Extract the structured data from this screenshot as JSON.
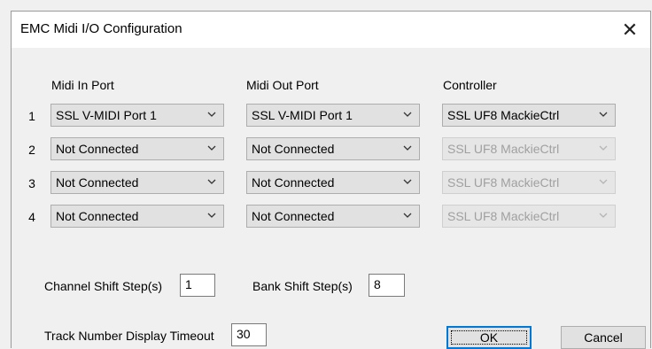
{
  "window": {
    "title": "EMC Midi I/O Configuration",
    "close_glyph": "✕"
  },
  "headers": {
    "midi_in": "Midi In Port",
    "midi_out": "Midi Out Port",
    "controller": "Controller"
  },
  "rows": [
    {
      "num": "1",
      "midi_in": "SSL V-MIDI Port 1",
      "midi_out": "SSL V-MIDI Port 1",
      "controller": "SSL UF8 MackieCtrl",
      "controller_enabled": true
    },
    {
      "num": "2",
      "midi_in": "Not Connected",
      "midi_out": "Not Connected",
      "controller": "SSL UF8 MackieCtrl",
      "controller_enabled": false
    },
    {
      "num": "3",
      "midi_in": "Not Connected",
      "midi_out": "Not Connected",
      "controller": "SSL UF8 MackieCtrl",
      "controller_enabled": false
    },
    {
      "num": "4",
      "midi_in": "Not Connected",
      "midi_out": "Not Connected",
      "controller": "SSL UF8 MackieCtrl",
      "controller_enabled": false
    }
  ],
  "settings": {
    "channel_shift_label": "Channel Shift Step(s)",
    "channel_shift_value": "1",
    "bank_shift_label": "Bank Shift Step(s)",
    "bank_shift_value": "8",
    "track_timeout_label": "Track Number Display Timeout",
    "track_timeout_value": "30"
  },
  "buttons": {
    "ok": "OK",
    "cancel": "Cancel"
  },
  "colors": {
    "focus_border": "#0078d7",
    "disabled_text": "#a0a0a0"
  },
  "icons": {
    "dropdown": "chevron-down-icon",
    "close": "close-icon"
  }
}
